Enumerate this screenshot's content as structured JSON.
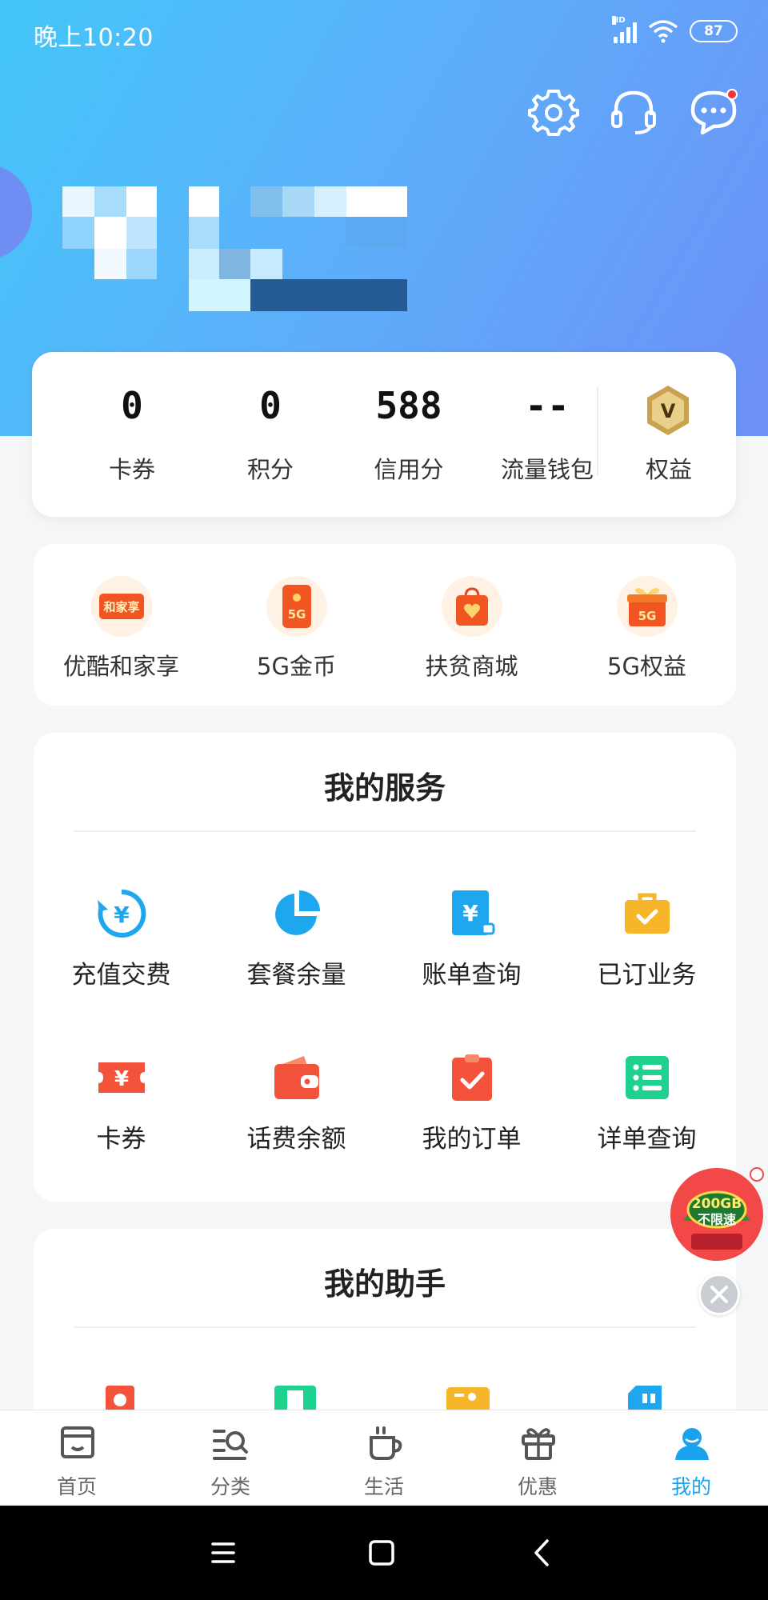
{
  "status_bar": {
    "time": "晚上10:20",
    "network_badge": "HD",
    "battery": "87",
    "icons": [
      "signal-icon",
      "wifi-icon",
      "battery-icon"
    ]
  },
  "header": {
    "icons": [
      "settings-icon",
      "customer-service-icon",
      "message-icon"
    ],
    "message_has_unread": true
  },
  "stats": [
    {
      "value": "0",
      "label": "卡券"
    },
    {
      "value": "0",
      "label": "积分"
    },
    {
      "value": "588",
      "label": "信用分"
    },
    {
      "value": "--",
      "label": "流量钱包"
    }
  ],
  "rights": {
    "label": "权益",
    "badge_letter": "V"
  },
  "promos": [
    {
      "label": "优酷和家享",
      "icon_text": "和家享",
      "icon": "family-share-icon"
    },
    {
      "label": "5G金币",
      "icon_text": "5G",
      "icon": "5g-phone-icon"
    },
    {
      "label": "扶贫商城",
      "icon_text": "",
      "icon": "shopping-bag-icon"
    },
    {
      "label": "5G权益",
      "icon_text": "5G",
      "icon": "5g-gift-icon"
    }
  ],
  "services": {
    "title": "我的服务",
    "items": [
      {
        "label": "充值交费",
        "icon": "recharge-icon"
      },
      {
        "label": "套餐余量",
        "icon": "pie-chart-icon"
      },
      {
        "label": "账单查询",
        "icon": "bill-icon"
      },
      {
        "label": "已订业务",
        "icon": "briefcase-icon"
      },
      {
        "label": "卡券",
        "icon": "coupon-icon"
      },
      {
        "label": "话费余额",
        "icon": "wallet-icon"
      },
      {
        "label": "我的订单",
        "icon": "order-icon"
      },
      {
        "label": "详单查询",
        "icon": "list-icon"
      }
    ]
  },
  "assistant": {
    "title": "我的助手"
  },
  "floating_promo": {
    "line1": "200GB",
    "line2": "不限速"
  },
  "tabs": [
    {
      "label": "首页",
      "icon": "home-icon",
      "active": false
    },
    {
      "label": "分类",
      "icon": "category-icon",
      "active": false
    },
    {
      "label": "生活",
      "icon": "cup-icon",
      "active": false
    },
    {
      "label": "优惠",
      "icon": "gift-icon",
      "active": false
    },
    {
      "label": "我的",
      "icon": "profile-icon",
      "active": true
    }
  ],
  "colors": {
    "header_start": "#43c6f8",
    "header_end": "#6d8ff7",
    "active_tab": "#1aa2ef",
    "badge_red": "#f5313c"
  }
}
